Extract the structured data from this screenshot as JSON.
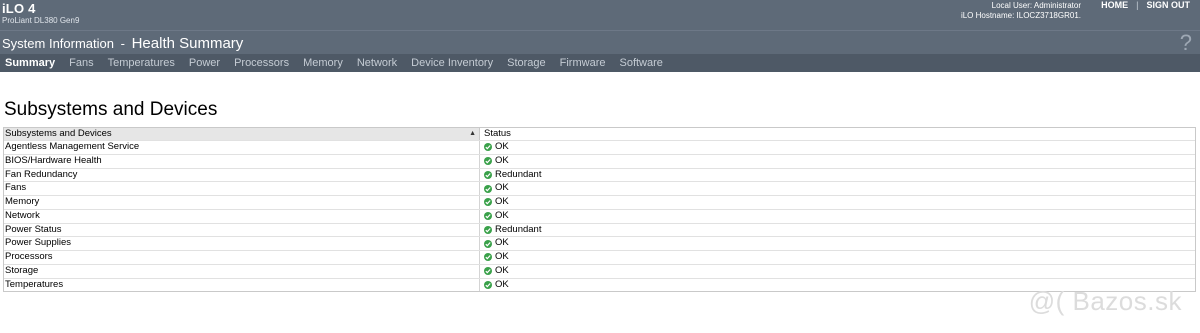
{
  "header": {
    "brand": "iLO 4",
    "model": "ProLiant DL380 Gen9",
    "local_user": "Local User: Administrator",
    "hostname": "iLO Hostname: ILOCZ3718GR01.",
    "home_label": "HOME",
    "separator": "|",
    "signout_label": "SIGN OUT"
  },
  "titlebar": {
    "section": "System Information",
    "separator": "-",
    "page": "Health Summary",
    "help": "?"
  },
  "tabs": [
    {
      "label": "Summary",
      "active": true
    },
    {
      "label": "Fans"
    },
    {
      "label": "Temperatures"
    },
    {
      "label": "Power"
    },
    {
      "label": "Processors"
    },
    {
      "label": "Memory"
    },
    {
      "label": "Network"
    },
    {
      "label": "Device Inventory"
    },
    {
      "label": "Storage"
    },
    {
      "label": "Firmware"
    },
    {
      "label": "Software"
    }
  ],
  "main": {
    "heading": "Subsystems and Devices",
    "table": {
      "columns": [
        "Subsystems and Devices",
        "Status"
      ],
      "sort_indicator": "▲",
      "rows": [
        {
          "name": "Agentless Management Service",
          "status": "OK"
        },
        {
          "name": "BIOS/Hardware Health",
          "status": "OK"
        },
        {
          "name": "Fan Redundancy",
          "status": "Redundant"
        },
        {
          "name": "Fans",
          "status": "OK"
        },
        {
          "name": "Memory",
          "status": "OK"
        },
        {
          "name": "Network",
          "status": "OK"
        },
        {
          "name": "Power Status",
          "status": "Redundant"
        },
        {
          "name": "Power Supplies",
          "status": "OK"
        },
        {
          "name": "Processors",
          "status": "OK"
        },
        {
          "name": "Storage",
          "status": "OK"
        },
        {
          "name": "Temperatures",
          "status": "OK"
        }
      ]
    }
  },
  "watermark": "@( Bazos.sk",
  "colors": {
    "header_bg": "#5e6a78",
    "tabs_bg": "#4e5966",
    "ok_green": "#3aa14a"
  }
}
